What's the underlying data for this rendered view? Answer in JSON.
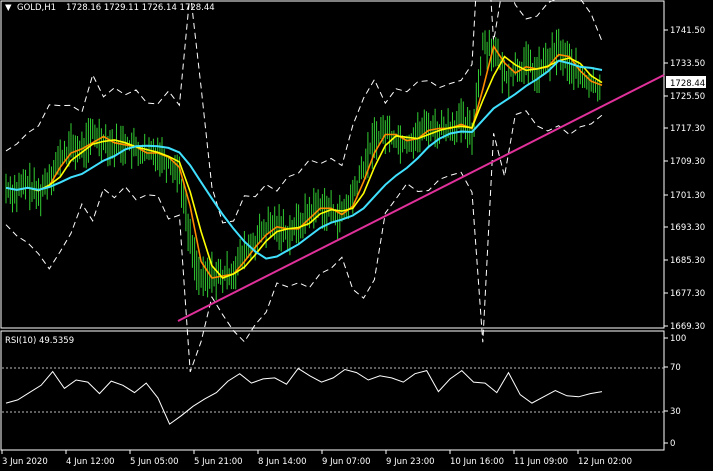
{
  "header": {
    "symbol": "GOLD,H1",
    "ohlc": "1728.16 1729.11 1726.14 1728.44",
    "collapse_glyph": "▼"
  },
  "price_axis": {
    "labels": [
      "1741.50",
      "1733.50",
      "1725.50",
      "1717.30",
      "1709.30",
      "1701.30",
      "1693.30",
      "1685.30",
      "1677.30",
      "1669.30"
    ],
    "current_price": "1728.44"
  },
  "rsi": {
    "label": "RSI(10) 49.5359",
    "axis_labels": [
      "100",
      "70",
      "30",
      "0"
    ],
    "levels": [
      70,
      30
    ]
  },
  "time_axis": {
    "labels": [
      "3 Jun 2020",
      "4 Jun 12:00",
      "5 Jun 05:00",
      "5 Jun 21:00",
      "8 Jun 14:00",
      "9 Jun 07:00",
      "9 Jun 23:00",
      "10 Jun 16:00",
      "11 Jun 09:00",
      "12 Jun 02:00"
    ]
  },
  "colors": {
    "background": "#000000",
    "candles": "#32cd32",
    "ema_fast": "#ff8c00",
    "ema_slow": "#ffff00",
    "sma_long": "#40e0ff",
    "bands": "#ffffff",
    "trendline": "#e0309a",
    "rsi_line": "#ffffff"
  },
  "chart_data": {
    "type": "candlestick",
    "series": [
      {
        "name": "GOLD,H1",
        "close_path": [
          1703,
          1702,
          1704,
          1701,
          1706,
          1710,
          1713,
          1712,
          1716,
          1715,
          1713,
          1714,
          1712,
          1711,
          1712,
          1709,
          1707,
          1690,
          1680,
          1682,
          1681,
          1683,
          1687,
          1690,
          1693,
          1694,
          1692,
          1694,
          1697,
          1699,
          1697,
          1696,
          1701,
          1708,
          1715,
          1717,
          1715,
          1714,
          1716,
          1718,
          1717,
          1718,
          1719,
          1716,
          1738,
          1737,
          1730,
          1732,
          1733,
          1731,
          1734,
          1737,
          1733,
          1730,
          1728,
          1728
        ]
      }
    ],
    "indicators": [
      "Moving Average",
      "Moving Average",
      "Moving Average",
      "Bollinger Bands",
      "Trendline"
    ],
    "rsi_path": [
      38,
      41,
      48,
      55,
      68,
      52,
      60,
      58,
      47,
      59,
      55,
      48,
      57,
      43,
      18,
      26,
      35,
      42,
      48,
      59,
      66,
      57,
      61,
      62,
      56,
      71,
      64,
      58,
      62,
      70,
      67,
      60,
      64,
      62,
      58,
      66,
      69,
      49,
      61,
      69,
      58,
      57,
      48,
      67,
      46,
      38,
      44,
      50,
      45,
      44,
      47,
      49
    ]
  }
}
